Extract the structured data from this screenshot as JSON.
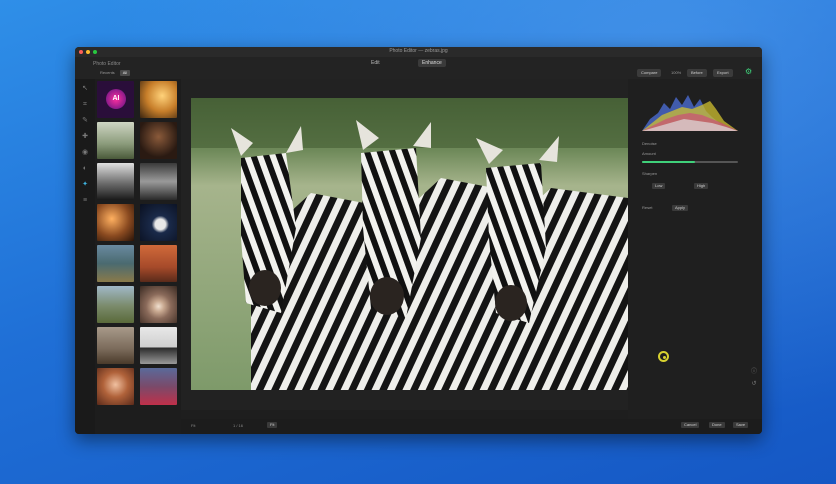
{
  "window": {
    "title": "Photo Editor — zebras.jpg",
    "app_name": "Photo Editor",
    "traffic_lights": [
      "#ff5f57",
      "#febc2e",
      "#28c840"
    ]
  },
  "topbar": {
    "mode_label": "Edit",
    "mode_button": "Enhance",
    "buttons": [
      "Compare",
      "Before",
      "Export"
    ],
    "mid_text": "100%",
    "gear_icon": "gear-icon"
  },
  "filmstrip": {
    "tabs": [
      "Recents",
      "All"
    ],
    "ai_logo_text": "AI",
    "thumbs": [
      {
        "name": "ai-logo",
        "color": "#2a0e3a"
      },
      {
        "name": "sunset",
        "color": "#c77e2a"
      },
      {
        "name": "ruins",
        "color": "#9aa38a"
      },
      {
        "name": "portrait-dark",
        "color": "#3a2a22"
      },
      {
        "name": "bw-car",
        "color": "#6c6c6c"
      },
      {
        "name": "bw-landscape",
        "color": "#5a5a5a"
      },
      {
        "name": "orange-portrait",
        "color": "#8a4a20"
      },
      {
        "name": "astronaut",
        "color": "#1a2a4a"
      },
      {
        "name": "tree-field",
        "color": "#4a6a70"
      },
      {
        "name": "red-rock",
        "color": "#a64a2a"
      },
      {
        "name": "field-person",
        "color": "#7a8a6a"
      },
      {
        "name": "mushroom",
        "color": "#8a6a5a"
      },
      {
        "name": "dog",
        "color": "#7a6a5a"
      },
      {
        "name": "horse",
        "color": "#cfcfcf"
      },
      {
        "name": "redhead",
        "color": "#b0623a"
      },
      {
        "name": "red-dress",
        "color": "#7a4a6a"
      }
    ]
  },
  "tools": [
    "select-icon",
    "crop-icon",
    "brush-icon",
    "heal-icon",
    "eye-icon",
    "mask-icon",
    "adjust-icon",
    "layers-icon"
  ],
  "right_panel": {
    "section_label": "Denoise",
    "amount_label": "Amount",
    "amount_value": 0.55,
    "sharpen_label": "Sharpen",
    "apply_button": "Apply",
    "mode_buttons": [
      "Low",
      "High"
    ],
    "reset_label": "Reset"
  },
  "bottom": {
    "zoom_label": "Fit",
    "page_info": "1 / 16",
    "buttons_right": [
      "Cancel",
      "Done",
      "Save"
    ]
  },
  "colors": {
    "accent": "#3fd07a",
    "cursor": "#d8d230",
    "desktop": "#1f6fd6"
  }
}
